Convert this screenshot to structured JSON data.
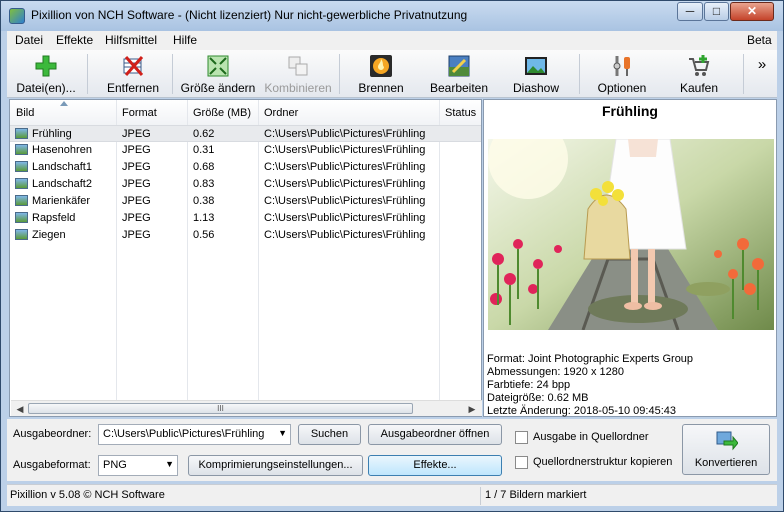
{
  "window": {
    "title": "Pixillion von NCH Software - (Nicht lizenziert) Nur nicht-gewerbliche Privatnutzung",
    "min": "─",
    "max": "□",
    "close": "✕"
  },
  "menu": {
    "items": [
      "Datei",
      "Effekte",
      "Hilfsmittel",
      "Hilfe"
    ],
    "beta": "Beta"
  },
  "toolbar": {
    "buttons": [
      {
        "label": "Datei(en)..."
      },
      {
        "label": "Entfernen"
      },
      {
        "label": "Größe ändern"
      },
      {
        "label": "Kombinieren"
      },
      {
        "label": "Brennen"
      },
      {
        "label": "Bearbeiten"
      },
      {
        "label": "Diashow"
      },
      {
        "label": "Optionen"
      },
      {
        "label": "Kaufen"
      }
    ],
    "more": "»"
  },
  "list": {
    "headers": [
      "Bild",
      "Format",
      "Größe (MB)",
      "Ordner",
      "Status"
    ],
    "rows": [
      {
        "name": "Frühling",
        "format": "JPEG",
        "size": "0.62",
        "folder": "C:\\Users\\Public\\Pictures\\Frühling"
      },
      {
        "name": "Hasenohren",
        "format": "JPEG",
        "size": "0.31",
        "folder": "C:\\Users\\Public\\Pictures\\Frühling"
      },
      {
        "name": "Landschaft1",
        "format": "JPEG",
        "size": "0.68",
        "folder": "C:\\Users\\Public\\Pictures\\Frühling"
      },
      {
        "name": "Landschaft2",
        "format": "JPEG",
        "size": "0.83",
        "folder": "C:\\Users\\Public\\Pictures\\Frühling"
      },
      {
        "name": "Marienkäfer",
        "format": "JPEG",
        "size": "0.38",
        "folder": "C:\\Users\\Public\\Pictures\\Frühling"
      },
      {
        "name": "Rapsfeld",
        "format": "JPEG",
        "size": "1.13",
        "folder": "C:\\Users\\Public\\Pictures\\Frühling"
      },
      {
        "name": "Ziegen",
        "format": "JPEG",
        "size": "0.56",
        "folder": "C:\\Users\\Public\\Pictures\\Frühling"
      }
    ],
    "scroll_grip": "III",
    "scroll_left": "◀",
    "scroll_right": "▶"
  },
  "preview": {
    "title": "Frühling",
    "info": [
      "Format: Joint Photographic Experts Group",
      "Abmessungen: 1920 x 1280",
      "Farbtiefe: 24 bpp",
      "Dateigröße: 0.62 MB",
      "Letzte Änderung: 2018-05-10 09:45:43"
    ]
  },
  "output": {
    "folder_label": "Ausgabeordner:",
    "folder_value": "C:\\Users\\Public\\Pictures\\Frühling",
    "search_button": "Suchen",
    "open_folder_button": "Ausgabeordner öffnen",
    "format_label": "Ausgabeformat:",
    "format_value": "PNG",
    "compression_button": "Komprimierungseinstellungen...",
    "effects_button": "Effekte...",
    "checkbox_source": "Ausgabe in Quellordner",
    "checkbox_structure": "Quellordnerstruktur kopieren",
    "convert_button": "Konvertieren"
  },
  "status": {
    "version": "Pixillion v 5.08 © NCH Software",
    "selection": "1 / 7 Bildern markiert"
  }
}
